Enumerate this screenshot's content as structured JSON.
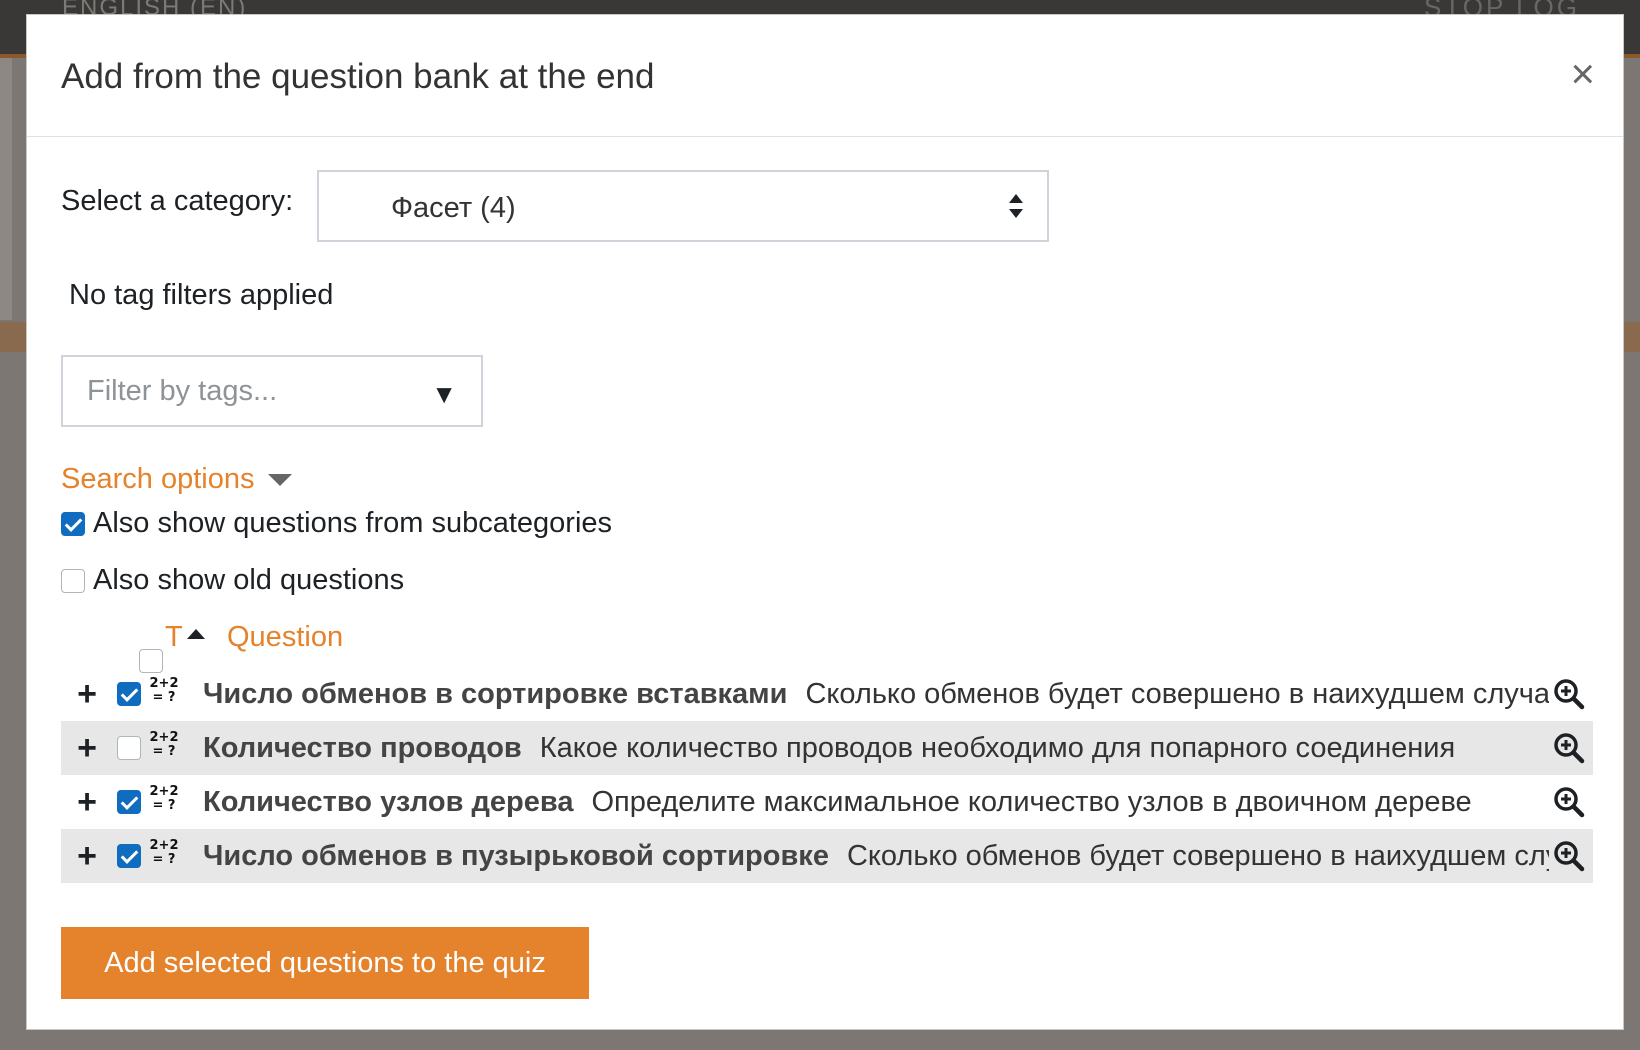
{
  "backdrop": {
    "language": "ENGLISH (EN)",
    "user": "STOP LOG"
  },
  "modal": {
    "title": "Add from the question bank at the end",
    "close_label": "×"
  },
  "category": {
    "label": "Select a category:",
    "selected": "Фасет (4)"
  },
  "tags": {
    "status": "No tag filters applied",
    "placeholder": "Filter by tags...",
    "arrow": "▼"
  },
  "search_options": {
    "label": "Search options",
    "subcategories": {
      "label": "Also show questions from subcategories",
      "checked": true
    },
    "old_questions": {
      "label": "Also show old questions",
      "checked": false
    }
  },
  "table": {
    "col_type": "T",
    "col_question": "Question",
    "rows": [
      {
        "name": "Число обменов в сортировке вставками",
        "text": "Сколько обменов будет совершено в наихудшем случае",
        "checked": true,
        "type_icon": "2+2=?"
      },
      {
        "name": "Количество проводов",
        "text": "Какое количество проводов необходимо для попарного соединения",
        "checked": false,
        "type_icon": "2+2=?"
      },
      {
        "name": "Количество узлов дерева",
        "text": "Определите максимальное количество узлов в двоичном дереве",
        "checked": true,
        "type_icon": "2+2=?"
      },
      {
        "name": "Число обменов в пузырьковой сортировке",
        "text": "Сколько обменов будет совершено в наихудшем случае",
        "checked": true,
        "type_icon": "2+2=?"
      }
    ]
  },
  "add_button": "Add selected questions to the quiz",
  "colors": {
    "accent": "#e5822c",
    "checkbox": "#0f6cbf",
    "alt_row": "#e7e7e7"
  }
}
